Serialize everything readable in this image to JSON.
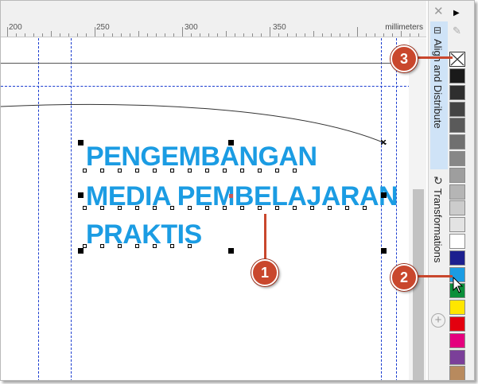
{
  "ruler": {
    "labels": [
      "200",
      "250",
      "300",
      "350"
    ],
    "unit": "millimeters"
  },
  "text_object": {
    "lines": [
      "PENGEMBANGAN",
      "MEDIA PEMBELAJARAN",
      "PRAKTIS"
    ],
    "color": "#1b9ce3"
  },
  "docker_tabs": {
    "align": "Align and Distribute",
    "transform": "Transformations"
  },
  "icons": {
    "close": "close-icon",
    "pin": "pin-icon",
    "arrow": "arrow-right-icon",
    "eyedropper": "eyedropper-icon",
    "add": "add-icon",
    "no_fill": "no-fill-icon"
  },
  "palette": {
    "colors": [
      "#1a1a1a",
      "#2e2e2e",
      "#444444",
      "#5a5a5a",
      "#707070",
      "#878787",
      "#9e9e9e",
      "#b5b5b5",
      "#cccccc",
      "#e3e3e3",
      "#ffffff",
      "#1c1f8f",
      "#1b9ce3",
      "#0b8f3a",
      "#ffe600",
      "#e3000f",
      "#e4007e",
      "#7b3f99",
      "#b88a5e"
    ]
  },
  "callouts": [
    "1",
    "2",
    "3"
  ]
}
